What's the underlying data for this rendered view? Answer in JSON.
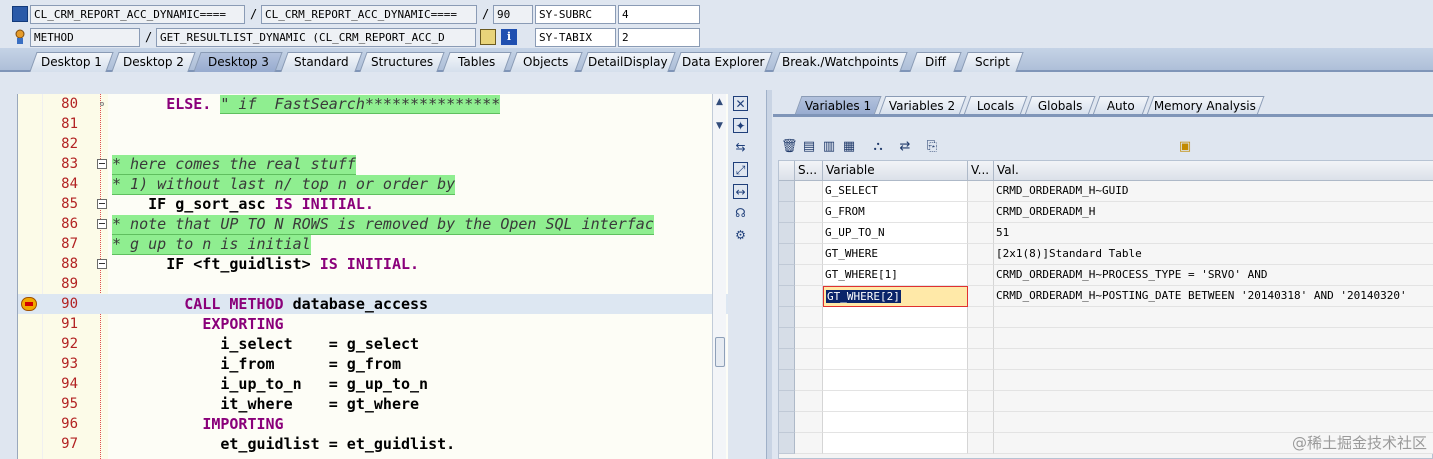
{
  "header": {
    "row1": {
      "program": "CL_CRM_REPORT_ACC_DYNAMIC====",
      "include": "CL_CRM_REPORT_ACC_DYNAMIC====",
      "line": "90",
      "sysfield": "SY-SUBRC",
      "sysvalue": "4"
    },
    "row2": {
      "event_type": "METHOD",
      "event": "GET_RESULTLIST_DYNAMIC (CL_CRM_REPORT_ACC_D",
      "sysfield": "SY-TABIX",
      "sysvalue": "2"
    },
    "separator": "/"
  },
  "main_tabs": [
    "Desktop 1",
    "Desktop 2",
    "Desktop 3",
    "Standard",
    "Structures",
    "Tables",
    "Objects",
    "DetailDisplay",
    "Data Explorer",
    "Break./Watchpoints",
    "Diff",
    "Script"
  ],
  "code_lines": [
    {
      "num": "80",
      "parts": [
        {
          "t": "      ",
          "c": ""
        },
        {
          "t": "ELSE.",
          "c": "kw"
        },
        {
          "t": " ",
          "c": ""
        },
        {
          "t": "\" if  FastSearch***************",
          "c": "str"
        }
      ]
    },
    {
      "num": "81",
      "parts": []
    },
    {
      "num": "82",
      "parts": []
    },
    {
      "num": "83",
      "parts": [
        {
          "t": "* here comes the real stuff",
          "c": "cm"
        }
      ]
    },
    {
      "num": "84",
      "parts": [
        {
          "t": "* 1) without last n/ top n or order by",
          "c": "cm"
        }
      ]
    },
    {
      "num": "85",
      "parts": [
        {
          "t": "    ",
          "c": ""
        },
        {
          "t": "IF",
          "c": ""
        },
        {
          "t": " g_sort_asc ",
          "c": ""
        },
        {
          "t": "IS INITIAL.",
          "c": "kw"
        }
      ]
    },
    {
      "num": "86",
      "parts": [
        {
          "t": "* note that UP TO N ROWS is removed by the Open SQL interfac",
          "c": "cm"
        }
      ]
    },
    {
      "num": "87",
      "parts": [
        {
          "t": "* g up to n is initial",
          "c": "cm"
        }
      ]
    },
    {
      "num": "88",
      "parts": [
        {
          "t": "      ",
          "c": ""
        },
        {
          "t": "IF",
          "c": ""
        },
        {
          "t": " <ft_guidlist> ",
          "c": ""
        },
        {
          "t": "IS INITIAL.",
          "c": "kw"
        }
      ]
    },
    {
      "num": "89",
      "parts": []
    },
    {
      "num": "90",
      "parts": [
        {
          "t": "        ",
          "c": ""
        },
        {
          "t": "CALL METHOD",
          "c": "kw"
        },
        {
          "t": " database_access",
          "c": ""
        }
      ]
    },
    {
      "num": "91",
      "parts": [
        {
          "t": "          ",
          "c": ""
        },
        {
          "t": "EXPORTING",
          "c": "kw"
        }
      ]
    },
    {
      "num": "92",
      "parts": [
        {
          "t": "            i_select    = g_select",
          "c": ""
        }
      ]
    },
    {
      "num": "93",
      "parts": [
        {
          "t": "            i_from      = g_from",
          "c": ""
        }
      ]
    },
    {
      "num": "94",
      "parts": [
        {
          "t": "            i_up_to_n   = g_up_to_n",
          "c": ""
        }
      ]
    },
    {
      "num": "95",
      "parts": [
        {
          "t": "            it_where    = gt_where",
          "c": ""
        }
      ]
    },
    {
      "num": "96",
      "parts": [
        {
          "t": "          ",
          "c": ""
        },
        {
          "t": "IMPORTING",
          "c": "kw"
        }
      ]
    },
    {
      "num": "97",
      "parts": [
        {
          "t": "            et_guidlist = et_guidlist.",
          "c": ""
        }
      ]
    }
  ],
  "var_tabs": [
    "Variables 1",
    "Variables 2",
    "Locals",
    "Globals",
    "Auto",
    "Memory Analysis"
  ],
  "grid": {
    "columns": [
      "S...",
      "Variable",
      "V...",
      "Val."
    ],
    "rows": [
      {
        "variable": "G_SELECT",
        "value": "CRMD_ORDERADM_H~GUID"
      },
      {
        "variable": "G_FROM",
        "value": "CRMD_ORDERADM_H"
      },
      {
        "variable": "G_UP_TO_N",
        "value": "51"
      },
      {
        "variable": "GT_WHERE",
        "value": "[2x1(8)]Standard Table"
      },
      {
        "variable": "GT_WHERE[1]",
        "value": "CRMD_ORDERADM_H~PROCESS_TYPE = 'SRVO' AND"
      },
      {
        "variable": "GT_WHERE[2]",
        "value": "CRMD_ORDERADM_H~POSTING_DATE BETWEEN '20140318' AND '20140320'"
      }
    ]
  },
  "watermark": "@稀土掘金技术社区"
}
